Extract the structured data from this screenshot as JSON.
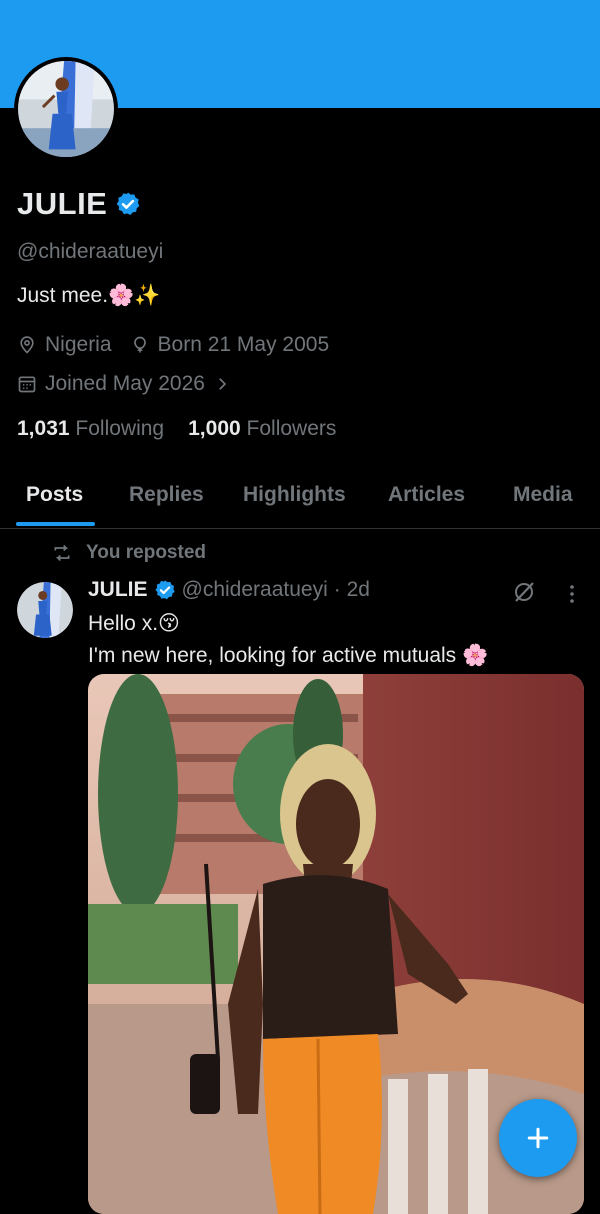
{
  "profile": {
    "name": "JULIE",
    "handle": "@chideraatueyi",
    "bio": "Just mee.🌸✨",
    "location": "Nigeria",
    "birthday": "Born 21 May 2005",
    "joined": "Joined May 2026",
    "following_count": "1,031",
    "following_label": "Following",
    "followers_count": "1,000",
    "followers_label": "Followers"
  },
  "tabs": [
    "Posts",
    "Replies",
    "Highlights",
    "Articles",
    "Media"
  ],
  "post": {
    "repost_label": "You reposted",
    "author_name": "JULIE",
    "author_handle": "@chideraatueyi",
    "time": "· 2d",
    "line1": "Hello x.😚",
    "line2": "I'm new here, looking for active mutuals 🌸"
  },
  "colors": {
    "accent": "#1d9bf0",
    "background": "#000000",
    "text": "#e7e9ea",
    "secondary_text": "#71767b"
  },
  "icons": {
    "verified": "verified-badge-icon",
    "location": "location-pin-icon",
    "birthday": "balloon-icon",
    "joined": "calendar-icon",
    "repost": "repost-icon",
    "grok": "grok-icon",
    "more": "more-vertical-icon",
    "compose": "plus-icon"
  }
}
